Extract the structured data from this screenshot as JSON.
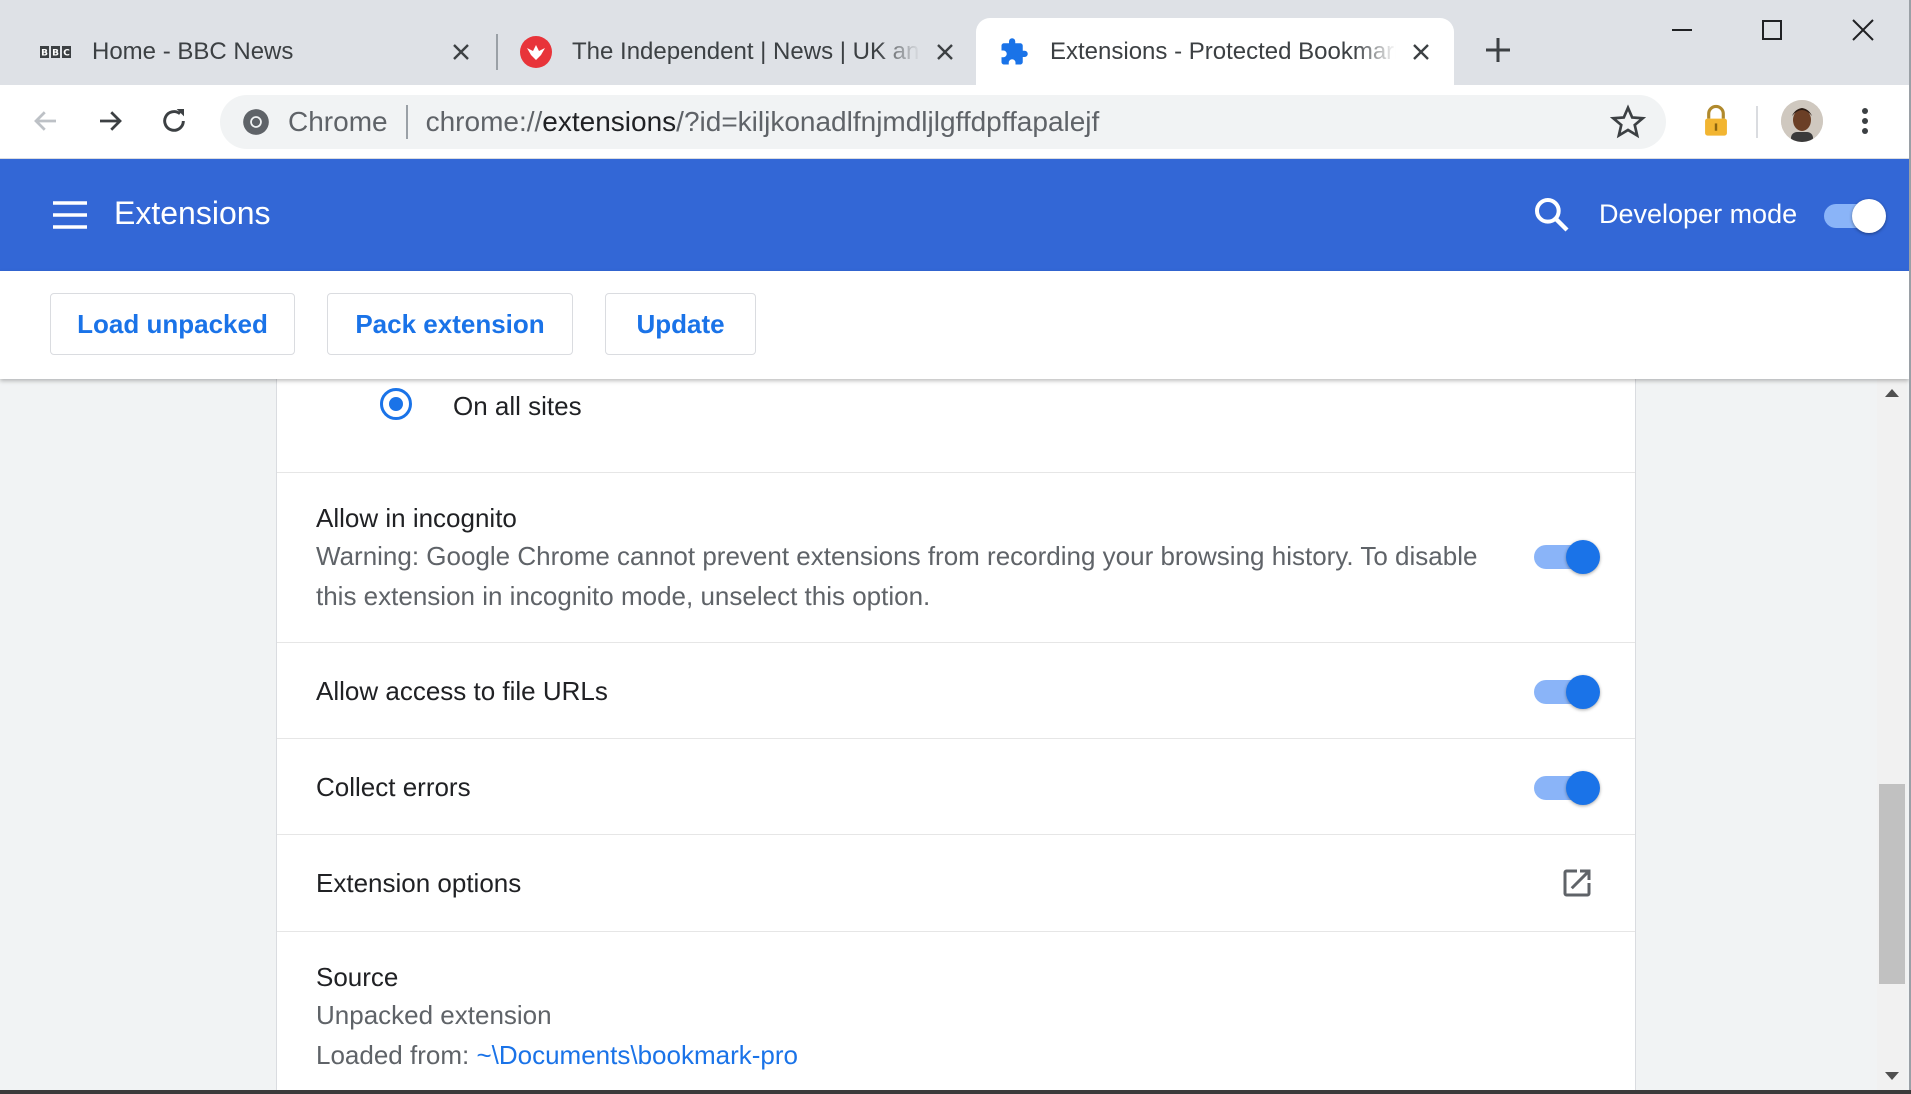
{
  "tabs": [
    {
      "title": "Home - BBC News",
      "favicon": "bbc-logo-icon",
      "active": false
    },
    {
      "title": "The Independent | News | UK and World",
      "favicon": "independent-eagle-icon",
      "active": false
    },
    {
      "title": "Extensions - Protected Bookmarks",
      "favicon": "puzzle-piece-icon",
      "active": true
    }
  ],
  "favicon_text": {
    "bbc": "BBC"
  },
  "window_controls": [
    "minimize-icon",
    "maximize-icon",
    "close-icon"
  ],
  "omnibox": {
    "site_chip": "Chrome",
    "url_scheme": "chrome://",
    "url_host": "extensions",
    "url_rest": "/?id=kiljkonadlfnjmdljlgffdpffapalejf"
  },
  "header": {
    "title": "Extensions",
    "developer_mode_label": "Developer mode",
    "developer_mode_on": true
  },
  "actions": {
    "load_unpacked": "Load unpacked",
    "pack_extension": "Pack extension",
    "update": "Update"
  },
  "details": {
    "site_access_option": "On all sites",
    "incognito": {
      "label": "Allow in incognito",
      "warning_line1": "Warning: Google Chrome cannot prevent extensions from recording your browsing history. To disable",
      "warning_line2": "this extension in incognito mode, unselect this option.",
      "on": true
    },
    "file_urls": {
      "label": "Allow access to file URLs",
      "on": true
    },
    "collect_errors": {
      "label": "Collect errors",
      "on": true
    },
    "extension_options": {
      "label": "Extension options"
    },
    "source": {
      "label": "Source",
      "type": "Unpacked extension",
      "loaded_from_label": "Loaded from: ",
      "loaded_from_path": "~\\Documents\\bookmark-pro"
    }
  },
  "colors": {
    "header_bg": "#3367d6",
    "accent": "#1a73e8",
    "toggle_track": "#8ab4f8",
    "tabstrip_bg": "#dee1e6"
  }
}
